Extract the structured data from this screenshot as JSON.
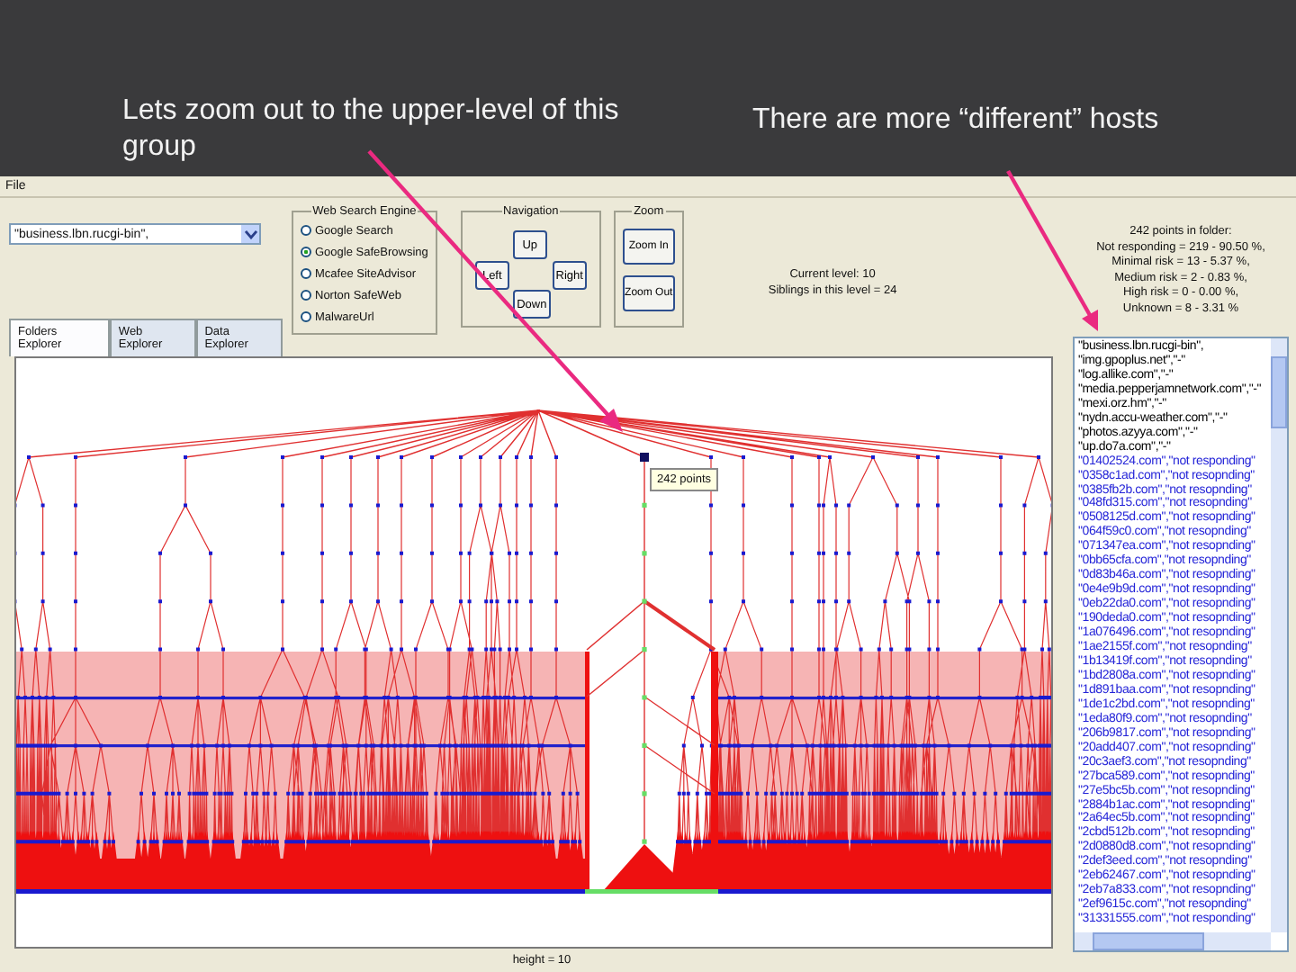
{
  "slide": {
    "captions": [
      "Lets zoom out to the upper-level of this group",
      "There are more “different” hosts"
    ]
  },
  "app": {
    "menu": [
      "File"
    ],
    "folder_combo": {
      "value": "\"business.lbn.rucgi-bin\","
    },
    "search_engine": {
      "title": "Web Search Engine",
      "options": [
        {
          "label": "Google Search",
          "selected": false
        },
        {
          "label": "Google SafeBrowsing",
          "selected": true
        },
        {
          "label": "Mcafee SiteAdvisor",
          "selected": false
        },
        {
          "label": "Norton SafeWeb",
          "selected": false
        },
        {
          "label": "MalwareUrl",
          "selected": false
        }
      ]
    },
    "navigation": {
      "title": "Navigation",
      "up": "Up",
      "left": "Left",
      "down": "Down",
      "right": "Right"
    },
    "zoom": {
      "title": "Zoom",
      "buttons": [
        "Zoom In",
        "Zoom Out"
      ]
    },
    "level_info": [
      "Current level: 10",
      "Siblings in this level = 24"
    ],
    "tabs": [
      {
        "label": "Folders Explorer",
        "selected": true
      },
      {
        "label": "Web Explorer",
        "selected": false
      },
      {
        "label": "Data Explorer",
        "selected": false
      }
    ],
    "tooltip": "242 points",
    "status": "height = 10",
    "folder_info": [
      "242 points in folder:",
      "Not responding = 219 - 90.50 %,",
      "Minimal risk = 13 - 5.37 %,",
      "Medium risk = 2 - 0.83 %,",
      "High risk = 0 - 0.00 %,",
      "Unknown = 8 - 3.31 %"
    ],
    "host_list": [
      {
        "text": "\"business.lbn.rucgi-bin\",",
        "color": "#000000"
      },
      {
        "text": "\"img.gpoplus.net\",\"-\"",
        "color": "#000000"
      },
      {
        "text": "\"log.allike.com\",\"-\"",
        "color": "#000000"
      },
      {
        "text": "\"media.pepperjamnetwork.com\",\"-\"",
        "color": "#000000"
      },
      {
        "text": "\"mexi.orz.hm\",\"-\"",
        "color": "#000000"
      },
      {
        "text": "\"nydn.accu-weather.com\",\"-\"",
        "color": "#000000"
      },
      {
        "text": "\"photos.azyya.com\",\"-\"",
        "color": "#000000"
      },
      {
        "text": "\"up.do7a.com\",\"-\"",
        "color": "#000000"
      },
      {
        "text": "\"01402524.com\",\"not responding\"",
        "color": "#2424d8"
      },
      {
        "text": "\"0358c1ad.com\",\"not resopnding\"",
        "color": "#2424d8"
      },
      {
        "text": "\"0385fb2b.com\",\"not resopnding\"",
        "color": "#2424d8"
      },
      {
        "text": "\"048fd315.com\",\"not resopnding\"",
        "color": "#2424d8"
      },
      {
        "text": "\"0508125d.com\",\"not resopnding\"",
        "color": "#2424d8"
      },
      {
        "text": "\"064f59c0.com\",\"not resopnding\"",
        "color": "#2424d8"
      },
      {
        "text": "\"071347ea.com\",\"not resopnding\"",
        "color": "#2424d8"
      },
      {
        "text": "\"0bb65cfa.com\",\"not resopnding\"",
        "color": "#2424d8"
      },
      {
        "text": "\"0d83b46a.com\",\"not resopnding\"",
        "color": "#2424d8"
      },
      {
        "text": "\"0e4e9b9d.com\",\"not resopnding\"",
        "color": "#2424d8"
      },
      {
        "text": "\"0eb22da0.com\",\"not resopnding\"",
        "color": "#2424d8"
      },
      {
        "text": "\"190deda0.com\",\"not resopnding\"",
        "color": "#2424d8"
      },
      {
        "text": "\"1a076496.com\",\"not resopnding\"",
        "color": "#2424d8"
      },
      {
        "text": "\"1ae2155f.com\",\"not resopnding\"",
        "color": "#2424d8"
      },
      {
        "text": "\"1b13419f.com\",\"not resopnding\"",
        "color": "#2424d8"
      },
      {
        "text": "\"1bd2808a.com\",\"not resopnding\"",
        "color": "#2424d8"
      },
      {
        "text": "\"1d891baa.com\",\"not resopnding\"",
        "color": "#2424d8"
      },
      {
        "text": "\"1de1c2bd.com\",\"not resopnding\"",
        "color": "#2424d8"
      },
      {
        "text": "\"1eda80f9.com\",\"not resopnding\"",
        "color": "#2424d8"
      },
      {
        "text": "\"206b9817.com\",\"not resopnding\"",
        "color": "#2424d8"
      },
      {
        "text": "\"20add407.com\",\"not resopnding\"",
        "color": "#2424d8"
      },
      {
        "text": "\"20c3aef3.com\",\"not resopnding\"",
        "color": "#2424d8"
      },
      {
        "text": "\"27bca589.com\",\"not resopnding\"",
        "color": "#2424d8"
      },
      {
        "text": "\"27e5bc5b.com\",\"not resopnding\"",
        "color": "#2424d8"
      },
      {
        "text": "\"2884b1ac.com\",\"not resopnding\"",
        "color": "#2424d8"
      },
      {
        "text": "\"2a64ec5b.com\",\"not resopnding\"",
        "color": "#2424d8"
      },
      {
        "text": "\"2cbd512b.com\",\"not resopnding\"",
        "color": "#2424d8"
      },
      {
        "text": "\"2d0880d8.com\",\"not resopnding\"",
        "color": "#2424d8"
      },
      {
        "text": "\"2def3eed.com\",\"not resopnding\"",
        "color": "#2424d8"
      },
      {
        "text": "\"2eb62467.com\",\"not resopnding\"",
        "color": "#2424d8"
      },
      {
        "text": "\"2eb7a833.com\",\"not resopnding\"",
        "color": "#2424d8"
      },
      {
        "text": "\"2ef9615c.com\",\"not resopnding\"",
        "color": "#2424d8"
      },
      {
        "text": "\"31331555.com\",\"not responding\"",
        "color": "#2424d8"
      }
    ]
  }
}
